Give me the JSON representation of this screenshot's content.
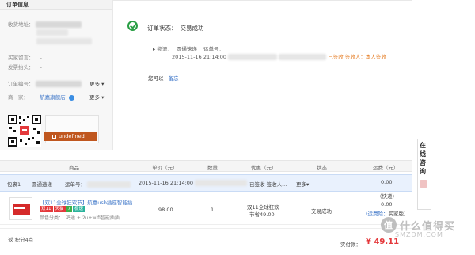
{
  "order_info": {
    "header": "订单信息",
    "shipping_address_label": "收货地址：",
    "buyer_message_label": "买家留言：",
    "buyer_message_value": "-",
    "invoice_title_label": "发票抬头：",
    "invoice_title_value": "-",
    "order_no_label": "订单编号：",
    "more_label": "更多",
    "seller_label": "商　家：",
    "shop_name": "航嘉旗舰店",
    "more_label_2": "更多",
    "undefined_label": "undefined"
  },
  "status": {
    "label": "订单状态：",
    "value": "交易成功",
    "logistics_label": "物流：",
    "carrier": "圆通速递",
    "tracking_label": "运单号：",
    "log_time": "2015-11-16 21:14:00",
    "signed_text": "已签收 签收人：本人签收",
    "suggest_label": "您可以",
    "suggest_link": "备忘"
  },
  "table": {
    "headers": {
      "product": "商品",
      "unit_price": "单价（元）",
      "quantity": "数量",
      "discount": "优惠（元）",
      "status": "状态",
      "shipping": "运费（元）"
    },
    "package": {
      "name": "包裹1",
      "carrier": "圆通速递",
      "tracking_label": "运单号：",
      "time": "2015-11-16 21:14:00",
      "signed": "已签收 签收人...",
      "more": "更多"
    },
    "item": {
      "title": "【双11全球狂欢节】航嘉usb插座智能插...",
      "badge_1": "双11",
      "badge_2": "天猫",
      "badge_3": "7",
      "badge_4": "极速",
      "attr": "颜色分类：　鸿途 + 2u+wifi智能插插",
      "price": "98.00",
      "quantity": "1",
      "discount_line1": "双11全球狂欢",
      "discount_line2": "节省49.00",
      "status": "交易成功",
      "shipping_line1": "0.00",
      "shipping_line2": "（快递）",
      "shipping_line3": "0.00",
      "shipping_line4": "（运费险：",
      "shipping_line4b": "买家版）"
    }
  },
  "footer": {
    "score": "返 积分4点",
    "paid_label": "实付款：",
    "paid_value": "¥ 49.11"
  },
  "sidebar": {
    "consult": "在线咨询"
  },
  "watermark": {
    "logo_text": "值",
    "text": "什么值得买",
    "sub": "SMZDM.COM"
  },
  "colors": {
    "success_green": "#2a9f45",
    "price_red": "#e4393c",
    "signed_orange": "#e57c23",
    "link_blue": "#3c75c8",
    "package_row_bg": "#e9f1fd"
  }
}
